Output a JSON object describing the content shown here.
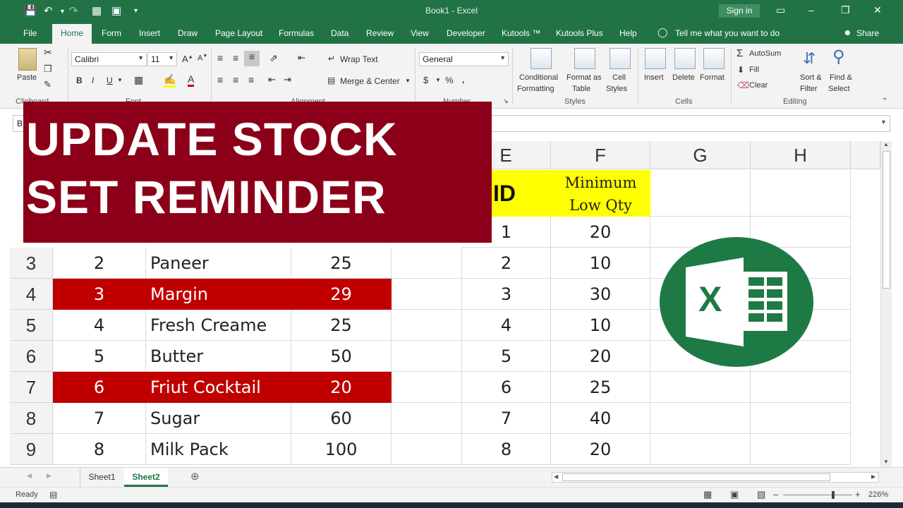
{
  "window": {
    "title": "Book1  -  Excel",
    "signin_label": "Sign in"
  },
  "tabs": [
    "File",
    "Home",
    "Form",
    "Insert",
    "Draw",
    "Page Layout",
    "Formulas",
    "Data",
    "Review",
    "View",
    "Developer",
    "Kutools ™",
    "Kutools Plus",
    "Help"
  ],
  "tellme": "Tell me what you want to do",
  "share": "Share",
  "ribbon": {
    "paste_label": "Paste",
    "clipboard_label": "Clipboard",
    "font_name": "Calibri",
    "font_size": "11",
    "font_label": "Font",
    "wrap_text": "Wrap Text",
    "merge_center": "Merge & Center",
    "alignment_label": "Alignment",
    "number_format": "General",
    "number_label": "Number",
    "conditional_formatting": [
      "Conditional",
      "Formatting"
    ],
    "format_as_table": [
      "Format as",
      "Table"
    ],
    "cell_styles": [
      "Cell",
      "Styles"
    ],
    "styles_label": "Styles",
    "insert": "Insert",
    "delete": "Delete",
    "format": "Format",
    "cells_label": "Cells",
    "autosum": "AutoSum",
    "fill": "Fill",
    "clear": "Clear",
    "sort_filter": [
      "Sort &",
      "Filter"
    ],
    "find_select": [
      "Find &",
      "Select"
    ],
    "editing_label": "Editing"
  },
  "namebox_partial": "B",
  "banner": {
    "line1": "UPDATE STOCK",
    "line2": "SET REMINDER"
  },
  "columns": [
    "E",
    "F",
    "G",
    "H"
  ],
  "rows": [
    {
      "num": "3",
      "a": "2",
      "b": "Paneer",
      "c": "25",
      "red": false,
      "e": "2",
      "f": "10"
    },
    {
      "num": "4",
      "a": "3",
      "b": "Margin",
      "c": "29",
      "red": true,
      "e": "3",
      "f": "30"
    },
    {
      "num": "5",
      "a": "4",
      "b": "Fresh Creame",
      "c": "25",
      "red": false,
      "e": "4",
      "f": "10"
    },
    {
      "num": "6",
      "a": "5",
      "b": "Butter",
      "c": "50",
      "red": false,
      "e": "5",
      "f": "20"
    },
    {
      "num": "7",
      "a": "6",
      "b": "Friut Cocktail",
      "c": "20",
      "red": true,
      "e": "6",
      "f": "25"
    },
    {
      "num": "8",
      "a": "7",
      "b": "Sugar",
      "c": "60",
      "red": false,
      "e": "7",
      "f": "40"
    },
    {
      "num": "9",
      "a": "8",
      "b": "Milk Pack",
      "c": "100",
      "red": false,
      "e": "8",
      "f": "20"
    }
  ],
  "row2": {
    "e": "1",
    "f": "20"
  },
  "header_id": "ID",
  "header_min": [
    "Minimum",
    "Low Qty"
  ],
  "logo_letter": "X",
  "sheets": [
    "Sheet1",
    "Sheet2"
  ],
  "active_sheet": "Sheet2",
  "status": {
    "ready": "Ready",
    "zoom": "226%"
  },
  "colors": {
    "excel_green": "#217346",
    "banner_red": "#8b0018",
    "highlight_red": "#c00000",
    "header_yellow": "#ffff00"
  }
}
